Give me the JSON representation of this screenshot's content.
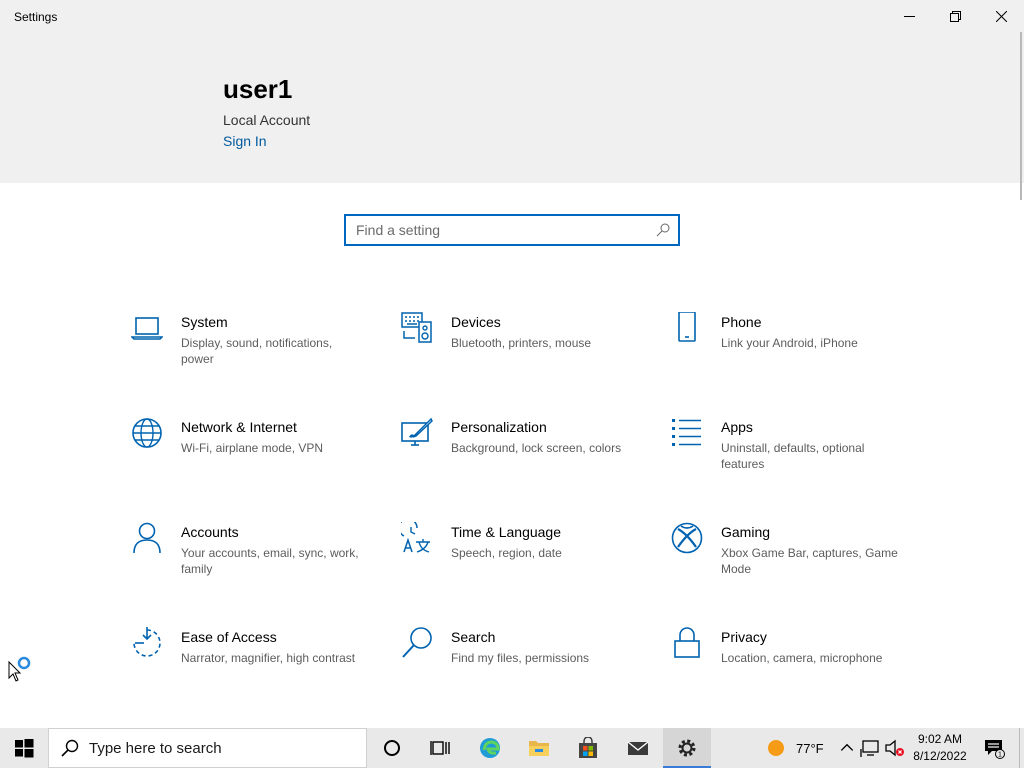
{
  "window": {
    "title": "Settings",
    "minimize_icon": "minimize-icon",
    "maximize_icon": "restore-icon",
    "close_icon": "close-icon"
  },
  "account": {
    "user_name": "user1",
    "account_type": "Local Account",
    "sign_in_label": "Sign In"
  },
  "search": {
    "placeholder": "Find a setting",
    "value": ""
  },
  "categories": [
    {
      "name": "System",
      "desc": "Display, sound, notifications, power",
      "icon": "laptop-icon"
    },
    {
      "name": "Devices",
      "desc": "Bluetooth, printers, mouse",
      "icon": "keyboard-speaker-icon"
    },
    {
      "name": "Phone",
      "desc": "Link your Android, iPhone",
      "icon": "phone-icon"
    },
    {
      "name": "Network & Internet",
      "desc": "Wi-Fi, airplane mode, VPN",
      "icon": "globe-icon"
    },
    {
      "name": "Personalization",
      "desc": "Background, lock screen, colors",
      "icon": "paintbrush-monitor-icon"
    },
    {
      "name": "Apps",
      "desc": "Uninstall, defaults, optional features",
      "icon": "apps-list-icon"
    },
    {
      "name": "Accounts",
      "desc": "Your accounts, email, sync, work, family",
      "icon": "person-icon"
    },
    {
      "name": "Time & Language",
      "desc": "Speech, region, date",
      "icon": "time-language-icon"
    },
    {
      "name": "Gaming",
      "desc": "Xbox Game Bar, captures, Game Mode",
      "icon": "xbox-icon"
    },
    {
      "name": "Ease of Access",
      "desc": "Narrator, magnifier, high contrast",
      "icon": "ease-of-access-icon"
    },
    {
      "name": "Search",
      "desc": "Find my files, permissions",
      "icon": "magnifier-icon"
    },
    {
      "name": "Privacy",
      "desc": "Location, camera, microphone",
      "icon": "padlock-icon"
    }
  ],
  "taskbar": {
    "search_placeholder": "Type here to search",
    "apps": [
      "cortana-icon",
      "task-view-icon",
      "edge-icon",
      "file-explorer-icon",
      "store-icon",
      "mail-icon",
      "settings-gear-icon"
    ],
    "weather": "77°F",
    "time": "9:02 AM",
    "date": "8/12/2022",
    "notification_count": "1"
  },
  "colors": {
    "accent": "#0067c0",
    "link": "#005a9e",
    "icon_blue": "#0063b1",
    "header_bg": "#f0f0f0",
    "taskbar_bg": "#e9e9e9"
  }
}
